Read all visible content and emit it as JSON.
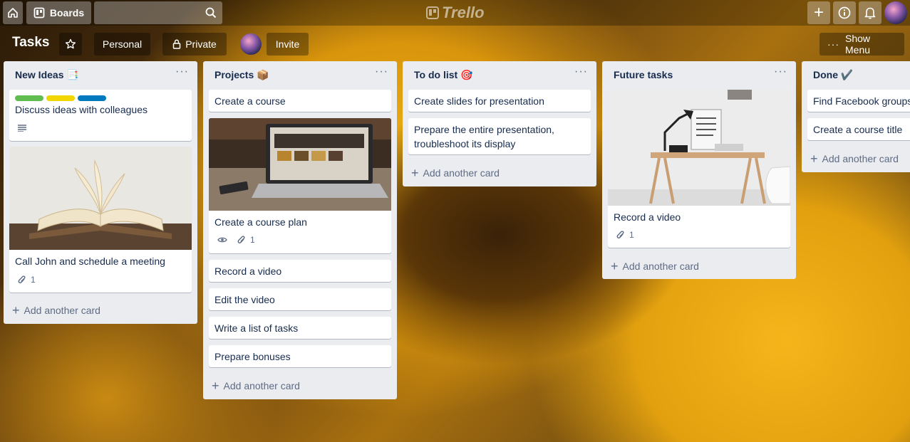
{
  "topbar": {
    "home_icon": "home-icon",
    "boards_label": "Boards",
    "search_value": "",
    "logo_text": "Trello",
    "add_icon": "plus-icon",
    "info_icon": "info-icon",
    "bell_icon": "bell-icon"
  },
  "board": {
    "title": "Tasks",
    "team_label": "Personal",
    "visibility_label": "Private",
    "invite_label": "Invite",
    "show_menu_label": "Show Menu"
  },
  "lists": [
    {
      "title": "New Ideas 📑",
      "label_colors": [
        "#61bd4f",
        "#f2d600",
        "#0079bf"
      ],
      "cards": [
        {
          "text": "Discuss ideas with colleagues",
          "description_icon": "description-icon"
        },
        {
          "text": "Call John and schedule a meeting",
          "attachments": "1",
          "cover": "open-book-photo"
        }
      ],
      "add_label": "Add another card"
    },
    {
      "title": "Projects 📦",
      "cards": [
        {
          "text": "Create a course"
        },
        {
          "text": "Create a course plan",
          "attachments": "1",
          "cover": "laptop-photo"
        },
        {
          "text": "Record a video"
        },
        {
          "text": "Edit the video"
        },
        {
          "text": "Write a list of tasks"
        },
        {
          "text": "Prepare bonuses"
        }
      ],
      "add_label": "Add another card"
    },
    {
      "title": "To do list 🎯",
      "cards": [
        {
          "text": "Create slides for presentation"
        },
        {
          "text": "Prepare the entire presentation, troubleshoot its display"
        }
      ],
      "add_label": "Add another card"
    },
    {
      "title": "Future tasks",
      "cards": [
        {
          "text": "Record a video",
          "attachments": "1",
          "cover": "desk-photo"
        }
      ],
      "add_label": "Add another card"
    },
    {
      "title": "Done ✔️",
      "cards": [
        {
          "text": "Find Facebook groups"
        },
        {
          "text": "Create a course title"
        }
      ],
      "add_label": "Add another card"
    }
  ]
}
